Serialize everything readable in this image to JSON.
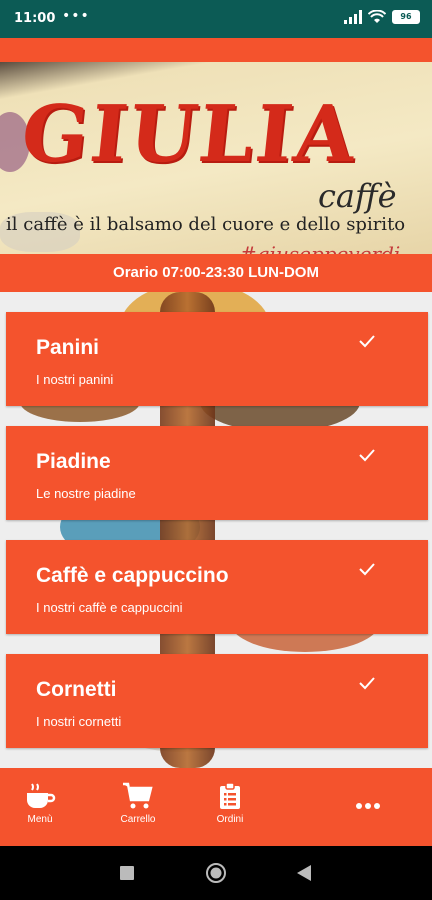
{
  "status_bar": {
    "time": "11:00",
    "dots": "•••",
    "battery": "96"
  },
  "banner": {
    "logo_text": "GIULIA",
    "caffe_text": "caffè",
    "motto": "il caffè è il balsamo del cuore e dello spirito",
    "hashtag": "#giuseppeverdi"
  },
  "hours": "Orario 07:00-23:30 LUN-DOM",
  "categories": [
    {
      "title": "Panini",
      "subtitle": "I nostri panini",
      "icon": "check-icon"
    },
    {
      "title": "Piadine",
      "subtitle": "Le nostre piadine",
      "icon": "check-icon"
    },
    {
      "title": "Caffè e cappuccino",
      "subtitle": "I nostri caffè e cappuccini",
      "icon": "check-icon"
    },
    {
      "title": "Cornetti",
      "subtitle": "I nostri cornetti",
      "icon": "check-icon"
    }
  ],
  "bottom_nav": [
    {
      "label": "Menù",
      "icon": "coffee-cup-icon"
    },
    {
      "label": "Carrello",
      "icon": "cart-icon"
    },
    {
      "label": "Ordini",
      "icon": "clipboard-icon"
    },
    {
      "label": "",
      "icon": "more-dots-icon"
    }
  ],
  "colors": {
    "accent": "#f4532d",
    "status_bar": "#0c5b55",
    "nav_bar": "#000000"
  }
}
